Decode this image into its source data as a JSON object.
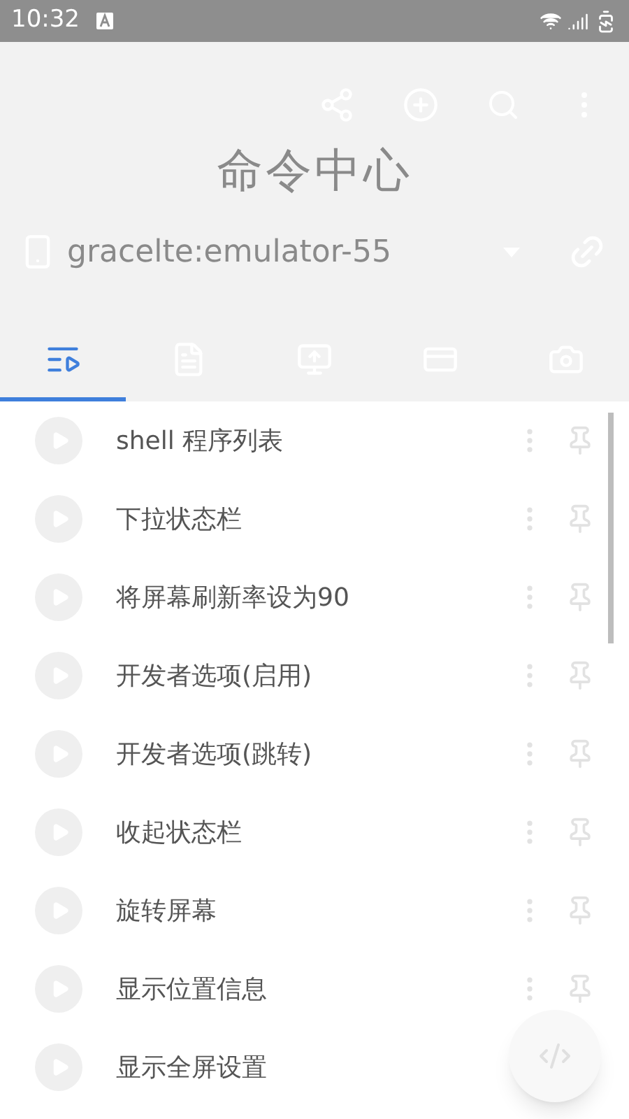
{
  "status_bar": {
    "time": "10:32"
  },
  "header": {
    "title": "命令中心",
    "device": "gracelte:emulator-55"
  },
  "tabs": [
    {
      "selected": true
    },
    {
      "selected": false
    },
    {
      "selected": false
    },
    {
      "selected": false
    },
    {
      "selected": false
    }
  ],
  "commands": [
    {
      "label": "shell 程序列表"
    },
    {
      "label": "下拉状态栏"
    },
    {
      "label": "将屏幕刷新率设为90"
    },
    {
      "label": "开发者选项(启用)"
    },
    {
      "label": "开发者选项(跳转)"
    },
    {
      "label": "收起状态栏"
    },
    {
      "label": "旋转屏幕"
    },
    {
      "label": "显示位置信息"
    },
    {
      "label": "显示全屏设置"
    }
  ]
}
